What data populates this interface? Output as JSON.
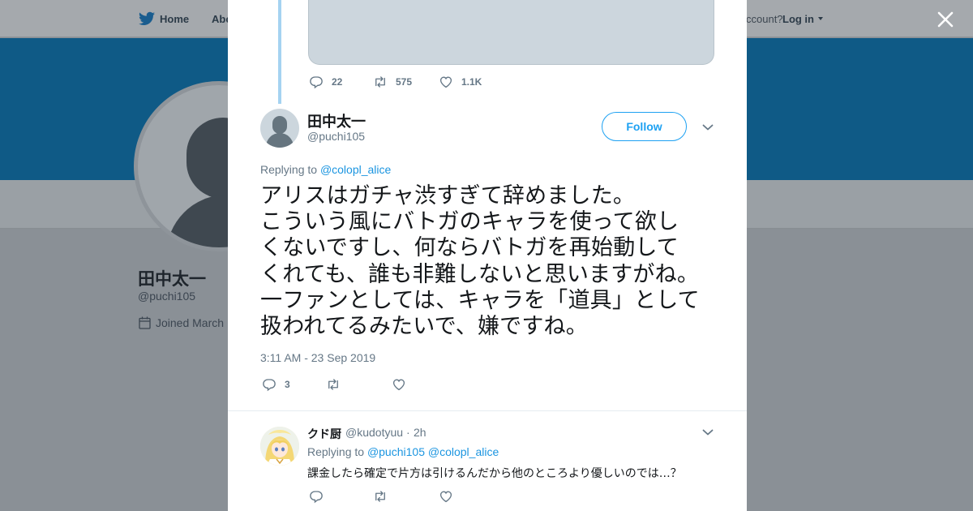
{
  "topnav": {
    "home_label": "Home",
    "about_label": "Abo",
    "account_text": "ccount?",
    "login_label": "Log in"
  },
  "profile": {
    "name": "田中太一",
    "handle": "@puchi105",
    "joined": "Joined March"
  },
  "colors": {
    "accent": "#1da1f2",
    "link": "#1b95e0",
    "banner": "#0f5a86",
    "overlay": "#8a9096"
  },
  "prev_tweet": {
    "reply_count": "22",
    "retweet_count": "575",
    "like_count": "1.1K"
  },
  "main_tweet": {
    "author_name": "田中太一",
    "author_handle": "@puchi105",
    "follow_label": "Follow",
    "replying_prefix": "Replying to",
    "replying_to": "@colopl_alice",
    "lines": [
      "アリスはガチャ渋すぎて辞めました。",
      "こういう風にバトガのキャラを使って欲し",
      "くないですし、何ならバトガを再始動して",
      "くれても、誰も非難しないと思いますがね。",
      "一ファンとしては、キャラを「道具」として",
      "扱われてるみたいで、嫌ですね。"
    ],
    "timestamp": "3:11 AM - 23 Sep 2019",
    "reply_count": "3",
    "retweet_count": "",
    "like_count": ""
  },
  "reply": {
    "author_name": "クド厨",
    "author_handle": "@kudotyuu",
    "separator": "·",
    "time": "2h",
    "replying_prefix": "Replying to",
    "replying_to": [
      "@puchi105",
      "@colopl_alice"
    ],
    "text": "課金したら確定で片方は引けるんだから他のところより優しいのでは…？"
  },
  "icons": {
    "nav": "twitter-bird-icon",
    "close": "close-icon",
    "reply": "reply-icon",
    "retweet": "retweet-icon",
    "like": "heart-icon",
    "menu": "chevron-down-icon",
    "calendar": "calendar-icon"
  }
}
